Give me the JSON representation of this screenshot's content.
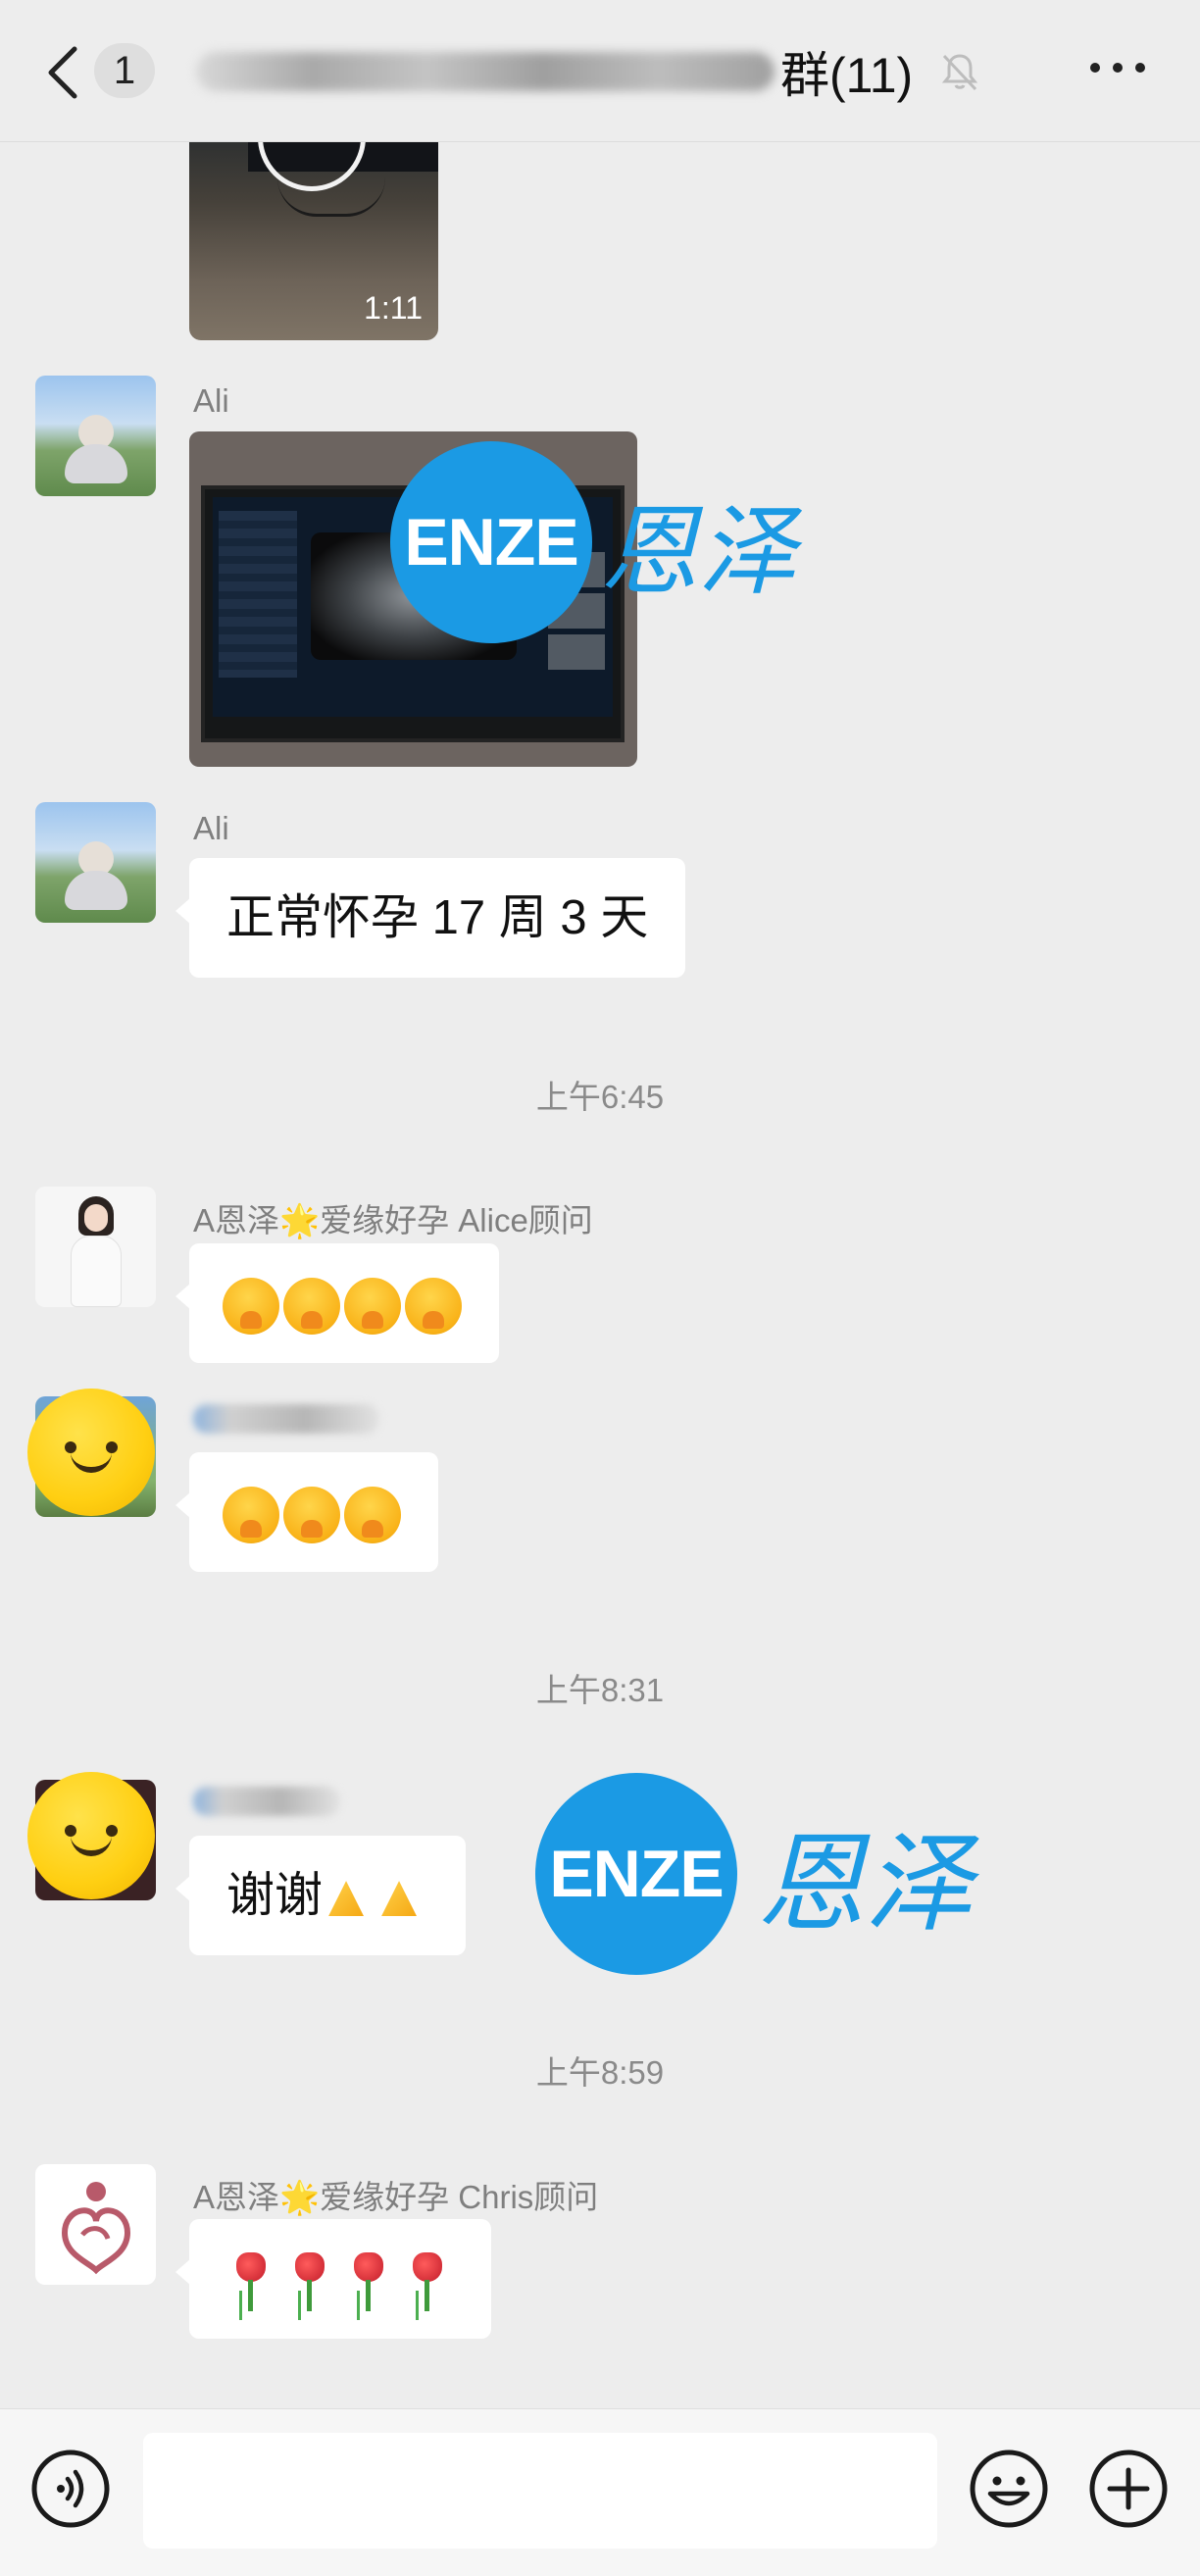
{
  "header": {
    "unread_count": "1",
    "group_title_suffix": "群(11)"
  },
  "video": {
    "duration": "1:11"
  },
  "messages": [
    {
      "sender": "Ali",
      "type": "image"
    },
    {
      "sender": "Ali",
      "text": "正常怀孕 17 周 3 天"
    },
    {
      "timestamp": "上午6:45"
    },
    {
      "sender": "A恩泽🌟爱缘好孕 Alice顾问",
      "emoji": [
        "hand-over-mouth",
        "hand-over-mouth",
        "hand-over-mouth",
        "hand-over-mouth"
      ]
    },
    {
      "sender": "",
      "emoji": [
        "hand-over-mouth",
        "hand-over-mouth",
        "hand-over-mouth"
      ]
    },
    {
      "timestamp": "上午8:31"
    },
    {
      "sender": "",
      "text": "谢谢",
      "emoji": [
        "folded-hands",
        "folded-hands"
      ]
    },
    {
      "timestamp": "上午8:59"
    },
    {
      "sender": "A恩泽🌟爱缘好孕 Chris顾问",
      "emoji": [
        "rose",
        "rose",
        "rose",
        "rose"
      ]
    }
  ],
  "watermark": {
    "circle_text": "ENZE",
    "brand_text": "恩泽"
  },
  "input": {
    "placeholder": ""
  },
  "colors": {
    "background": "#ededed",
    "bubble": "#ffffff",
    "watermark_blue": "#1b9ae4"
  }
}
